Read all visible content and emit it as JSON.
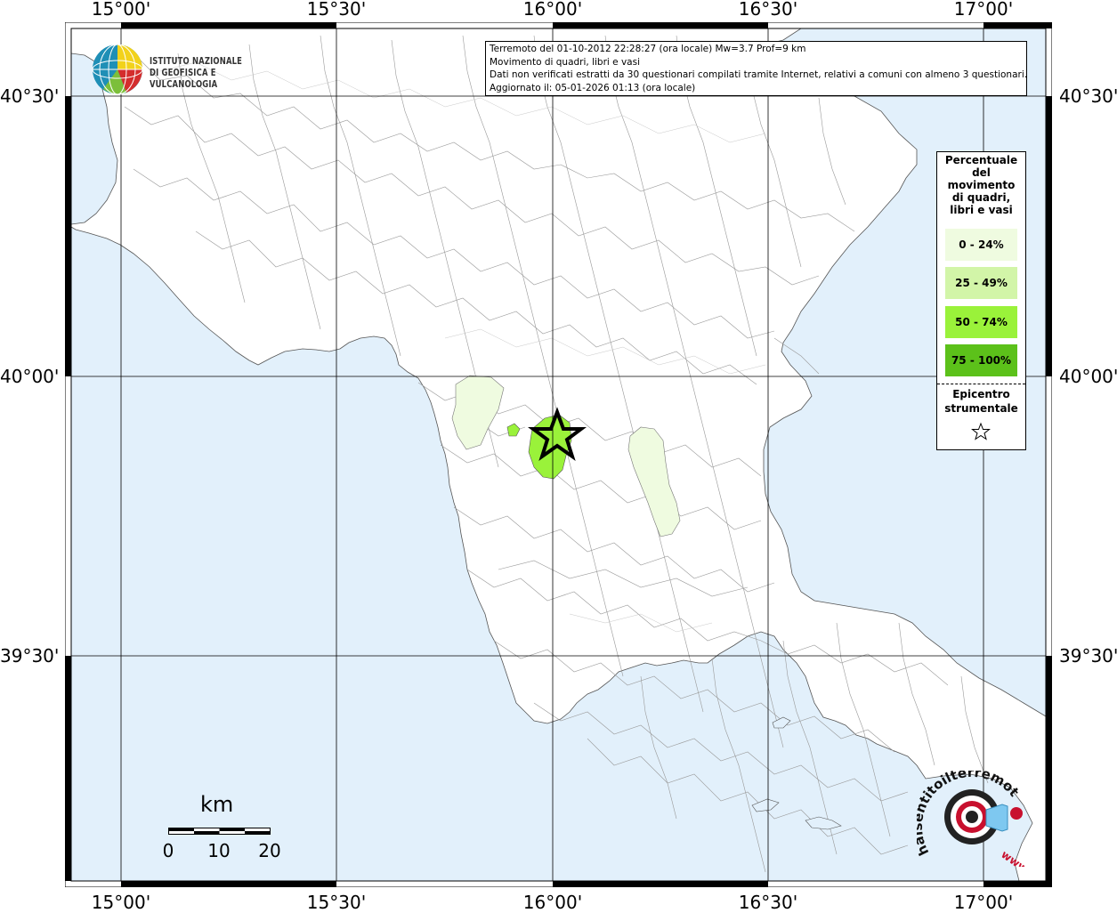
{
  "header": {
    "line1": "Terremoto del 01-10-2012 22:28:27 (ora locale) Mw=3.7 Prof=9 km",
    "line2": "Movimento di quadri, libri e vasi",
    "line3": "Dati non verificati estratti da 30 questionari compilati tramite Internet, relativi a comuni con almeno 3 questionari.",
    "line4": "Aggiornato il: 05-01-2026 01:13 (ora locale)"
  },
  "logo": {
    "line1": "ISTITUTO NAZIONALE",
    "line2": "DI GEOFISICA E VULCANOLOGIA"
  },
  "axes": {
    "lon_ticks": [
      "15°00'",
      "15°30'",
      "16°00'",
      "16°30'",
      "17°00'"
    ],
    "lat_ticks": [
      "40°30'",
      "40°00'",
      "39°30'"
    ]
  },
  "legend": {
    "title_lines": [
      "Percentuale",
      "del",
      "movimento",
      "di quadri,",
      "libri e vasi"
    ],
    "classes": [
      {
        "label": "0 - 24%",
        "color": "#effbe0"
      },
      {
        "label": "25 - 49%",
        "color": "#d2f5a8"
      },
      {
        "label": "50 - 74%",
        "color": "#9af23a"
      },
      {
        "label": "75 - 100%",
        "color": "#5cc11a"
      }
    ],
    "epicenter_lines": [
      "Epicentro",
      "strumentale"
    ]
  },
  "scale_bar": {
    "unit": "km",
    "labels": [
      "0",
      "10",
      "20"
    ]
  },
  "watermark": {
    "text": "haisentitoilterremoto.it",
    "url_text": "www"
  },
  "colors": {
    "sea": "#e2f0fb",
    "land": "#ffffff",
    "grid": "#000000",
    "epicenter": "#000000"
  },
  "map_data": {
    "epicenter": {
      "lon": 16.01,
      "lat": 39.92
    },
    "felt_areas": [
      {
        "name": "",
        "class": "50 - 74%"
      },
      {
        "name": "",
        "class": "25 - 49%"
      },
      {
        "name": "",
        "class": "0 - 24%"
      },
      {
        "name": "",
        "class": "0 - 24%"
      }
    ]
  }
}
